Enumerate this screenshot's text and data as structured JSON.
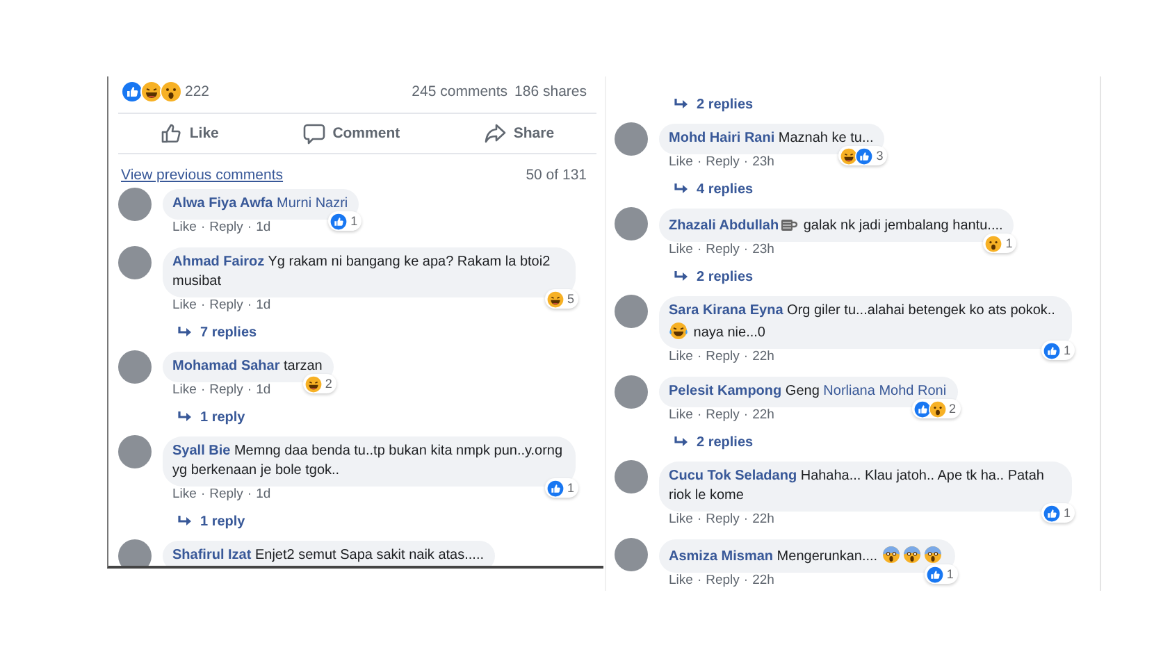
{
  "separator": "·",
  "left_panel": {
    "summary": {
      "reactions": [
        {
          "kind": "like"
        },
        {
          "kind": "laugh"
        },
        {
          "kind": "wow"
        }
      ],
      "count": "222",
      "comments": "245 comments",
      "shares": "186 shares"
    },
    "actions": [
      {
        "kind": "like",
        "label": "Like"
      },
      {
        "kind": "comment",
        "label": "Comment"
      },
      {
        "kind": "share",
        "label": "Share"
      }
    ],
    "view_previous": "View previous comments",
    "counter": "50 of 131",
    "items": [
      {
        "kind": "comment",
        "author": "Alwa Fiya Awfa",
        "parts": [
          {
            "kind": "tag",
            "text": "Murni Nazri"
          }
        ],
        "like": "Like",
        "reply": "Reply",
        "time": "1d",
        "reactions": {
          "icons": [
            {
              "kind": "like"
            }
          ],
          "count": "1"
        }
      },
      {
        "kind": "comment",
        "author": "Ahmad Fairoz",
        "parts": [
          {
            "kind": "text",
            "text": "Yg rakam ni bangang ke apa? Rakam la btoi2 musibat"
          }
        ],
        "like": "Like",
        "reply": "Reply",
        "time": "1d",
        "reactions": {
          "icons": [
            {
              "kind": "laugh"
            }
          ],
          "count": "5"
        }
      },
      {
        "kind": "replies",
        "label": "7 replies"
      },
      {
        "kind": "comment",
        "author": "Mohamad Sahar",
        "parts": [
          {
            "kind": "text",
            "text": "tarzan"
          }
        ],
        "like": "Like",
        "reply": "Reply",
        "time": "1d",
        "reactions": {
          "icons": [
            {
              "kind": "laugh"
            }
          ],
          "count": "2"
        }
      },
      {
        "kind": "replies",
        "label": "1 reply"
      },
      {
        "kind": "comment",
        "author": "Syall Bie",
        "parts": [
          {
            "kind": "text",
            "text": "Memng daa benda tu..tp bukan kita nmpk pun..y.orng yg berkenaan je bole tgok.."
          }
        ],
        "like": "Like",
        "reply": "Reply",
        "time": "1d",
        "reactions": {
          "icons": [
            {
              "kind": "like"
            }
          ],
          "count": "1"
        }
      },
      {
        "kind": "replies",
        "label": "1 reply"
      },
      {
        "kind": "comment",
        "author": "Shafirul Izat",
        "parts": [
          {
            "kind": "text",
            "text": "Enjet2 semut Sapa sakit naik atas....."
          }
        ]
      }
    ]
  },
  "right_panel": {
    "items": [
      {
        "kind": "replies",
        "label": "2 replies"
      },
      {
        "kind": "comment",
        "author": "Mohd Hairi Rani",
        "parts": [
          {
            "kind": "text",
            "text": "Maznah ke tu..."
          }
        ],
        "like": "Like",
        "reply": "Reply",
        "time": "23h",
        "reactions": {
          "icons": [
            {
              "kind": "laugh"
            },
            {
              "kind": "like"
            }
          ],
          "count": "3"
        }
      },
      {
        "kind": "replies",
        "label": "4 replies"
      },
      {
        "kind": "comment",
        "author": "Zhazali Abdullah",
        "parts": [
          {
            "kind": "mug_emoji"
          },
          {
            "kind": "text",
            "text": "galak nk jadi jembalang hantu...."
          }
        ],
        "like": "Like",
        "reply": "Reply",
        "time": "23h",
        "reactions": {
          "icons": [
            {
              "kind": "wow"
            }
          ],
          "count": "1"
        }
      },
      {
        "kind": "replies",
        "label": "2 replies"
      },
      {
        "kind": "comment",
        "author": "Sara Kirana Eyna",
        "parts": [
          {
            "kind": "text",
            "text": "Org giler tu...alahai betengek ko ats pokok.."
          },
          {
            "kind": "laugh_emoji"
          },
          {
            "kind": "text",
            "text": "naya nie...0"
          }
        ],
        "like": "Like",
        "reply": "Reply",
        "time": "22h",
        "reactions": {
          "icons": [
            {
              "kind": "like"
            }
          ],
          "count": "1"
        }
      },
      {
        "kind": "comment",
        "author": "Pelesit Kampong",
        "parts": [
          {
            "kind": "text",
            "text": "Geng"
          },
          {
            "kind": "tag",
            "text": "Norliana Mohd Roni"
          }
        ],
        "like": "Like",
        "reply": "Reply",
        "time": "22h",
        "reactions": {
          "icons": [
            {
              "kind": "like"
            },
            {
              "kind": "wow"
            }
          ],
          "count": "2"
        }
      },
      {
        "kind": "replies",
        "label": "2 replies"
      },
      {
        "kind": "comment",
        "author": "Cucu Tok Seladang",
        "parts": [
          {
            "kind": "text",
            "text": "Hahaha... Klau jatoh.. Ape tk ha.. Patah riok le kome"
          }
        ],
        "like": "Like",
        "reply": "Reply",
        "time": "22h",
        "reactions": {
          "icons": [
            {
              "kind": "like"
            }
          ],
          "count": "1"
        }
      },
      {
        "kind": "comment",
        "author": "Asmiza Misman",
        "parts": [
          {
            "kind": "text",
            "text": "Mengerunkan...."
          },
          {
            "kind": "scream_emoji"
          },
          {
            "kind": "scream_emoji"
          },
          {
            "kind": "scream_emoji"
          }
        ],
        "like": "Like",
        "reply": "Reply",
        "time": "22h",
        "reactions": {
          "icons": [
            {
              "kind": "like"
            }
          ],
          "count": "1"
        }
      }
    ]
  }
}
